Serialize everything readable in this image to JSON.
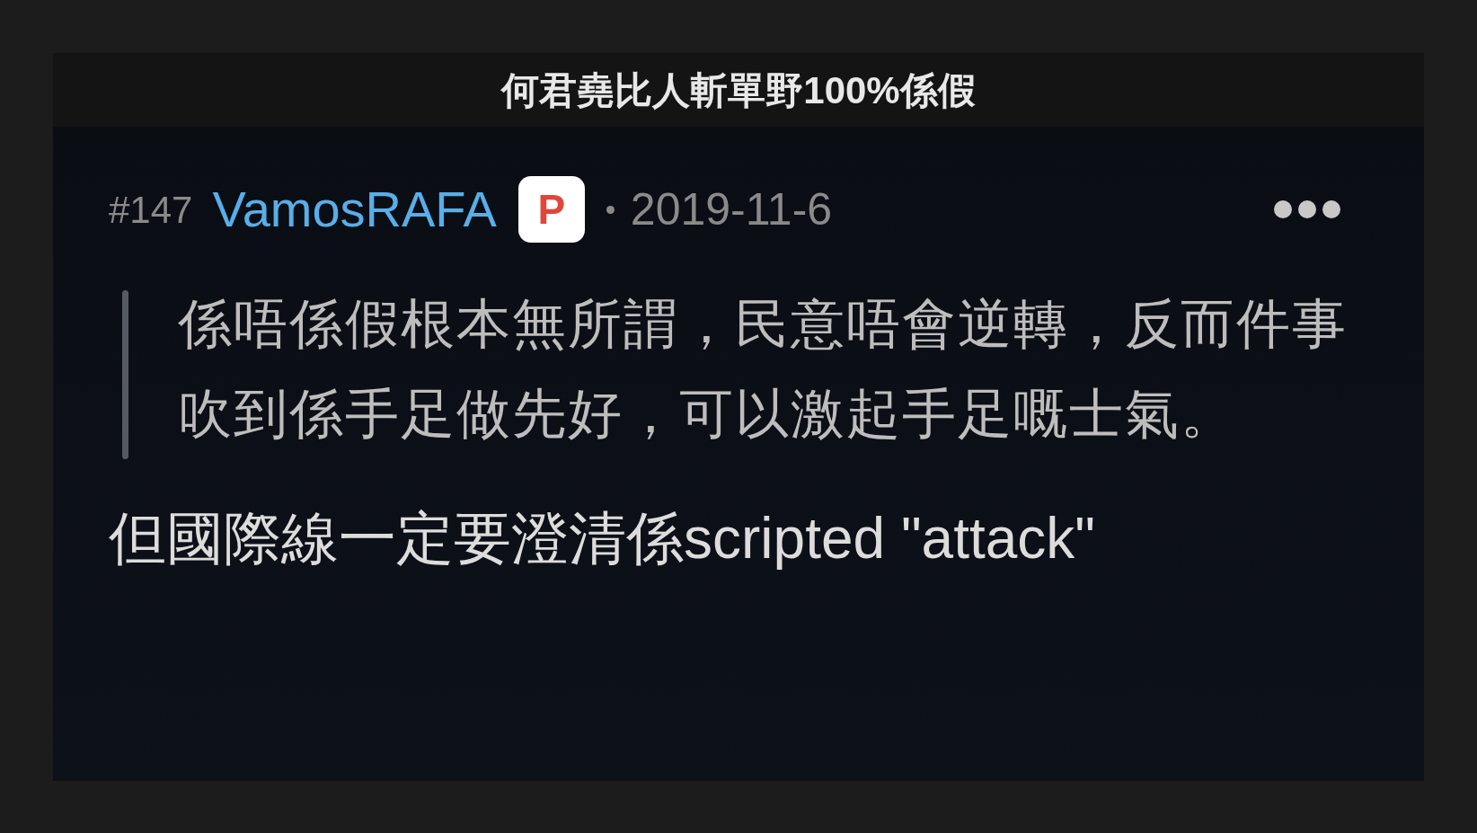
{
  "thread_title": "何君堯比人斬單野100%係假",
  "post": {
    "number": "#147",
    "username": "VamosRAFA",
    "badge": "P",
    "date": "2019-11-6",
    "quote": "係唔係假根本無所謂，民意唔會逆轉，反而件事吹到係手足做先好，可以激起手足嘅士氣。",
    "body": "但國際線一定要澄清係scripted \"attack\""
  }
}
